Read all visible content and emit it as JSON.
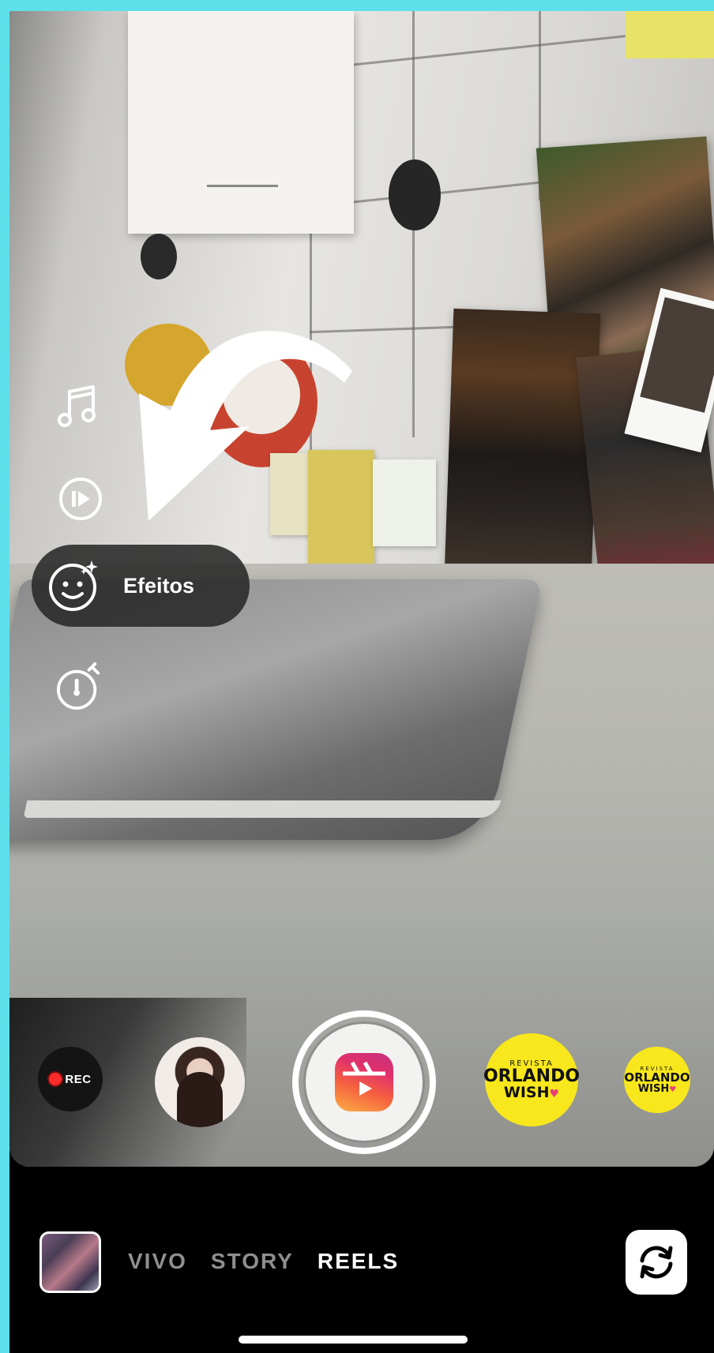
{
  "side_tools": {
    "music_icon": "music-note-icon",
    "speed_icon": "speed-icon",
    "effects": {
      "icon": "effects-face-icon",
      "label": "Efeitos"
    },
    "timer_icon": "timer-icon"
  },
  "capture": {
    "rec_label": "REC",
    "sticker_large": {
      "top": "REVISTA",
      "mid": "ORLANDO",
      "bot": "WISH"
    },
    "sticker_small": {
      "top": "REVISTA",
      "mid": "ORLANDO",
      "bot": "WISH"
    }
  },
  "modes": [
    "VIVO",
    "STORY",
    "REELS"
  ],
  "active_mode": "REELS",
  "colors": {
    "frame": "#5ee0ea",
    "reels_gradient_start": "#c5317f",
    "reels_gradient_end": "#fcaf45",
    "sticker": "#f8e71c"
  }
}
